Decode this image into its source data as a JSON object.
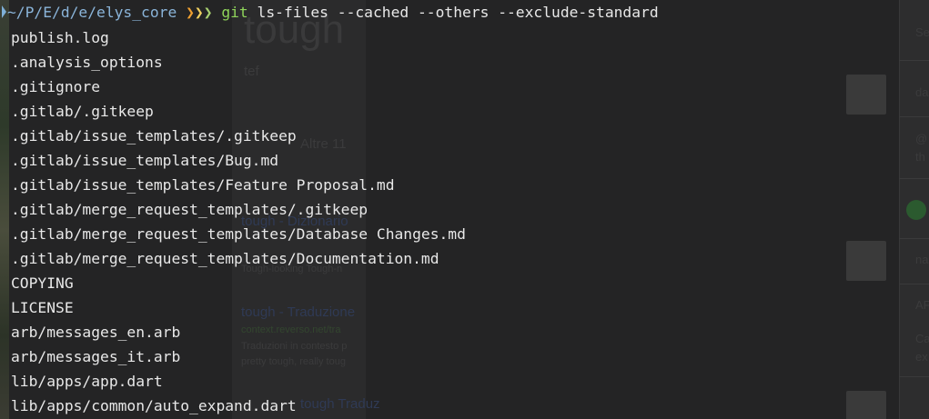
{
  "terminal": {
    "prompt": {
      "path": "~/P/E/d/e/elys_core",
      "arrows": [
        "❯",
        "❯",
        "❯"
      ],
      "command": "git",
      "args": "ls-files --cached --others --exclude-standard"
    },
    "output": [
      "publish.log",
      ".analysis_options",
      ".gitignore",
      ".gitlab/.gitkeep",
      ".gitlab/issue_templates/.gitkeep",
      ".gitlab/issue_templates/Bug.md",
      ".gitlab/issue_templates/Feature Proposal.md",
      ".gitlab/merge_request_templates/.gitkeep",
      ".gitlab/merge_request_templates/Database Changes.md",
      ".gitlab/merge_request_templates/Documentation.md",
      "COPYING",
      "LICENSE",
      "arb/messages_en.arb",
      "arb/messages_it.arb",
      "lib/apps/app.dart",
      "lib/apps/common/auto_expand.dart"
    ]
  },
  "background_window": {
    "heading": "tough",
    "subheading": "tef",
    "snippets": [
      "Altre 11",
      "tough - Dizionario",
      "Tough-looking   Tough-n",
      "tough - Traduzione",
      "context.reverso.net/tra",
      "Traduzioni in contesto p",
      "pretty tough, really toug",
      "tough Traduz"
    ],
    "side_snippets": [
      "Se",
      "da",
      "@",
      "th",
      "na",
      "AF",
      "Ca",
      "ex"
    ]
  },
  "colors": {
    "terminal_bg": "#242425",
    "text": "#e8e8e8",
    "path": "#8ab4d9",
    "command": "#8fd45a",
    "arrow_1": "#f0a030",
    "arrow_2": "#f0d060",
    "arrow_3": "#a8d070"
  }
}
